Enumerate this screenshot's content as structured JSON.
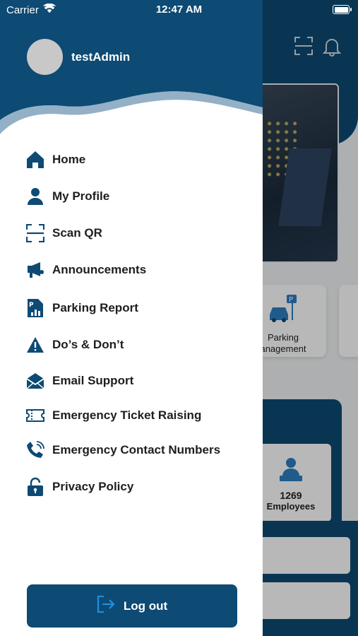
{
  "status_bar": {
    "carrier": "Carrier",
    "time": "12:47 AM"
  },
  "drawer": {
    "username": "testAdmin",
    "menu": [
      {
        "label": "Home",
        "icon": "home-icon"
      },
      {
        "label": "My Profile",
        "icon": "profile-icon"
      },
      {
        "label": "Scan QR",
        "icon": "scan-qr-icon"
      },
      {
        "label": "Announcements",
        "icon": "megaphone-icon"
      },
      {
        "label": "Parking Report",
        "icon": "report-icon"
      },
      {
        "label": "Do’s & Don’t",
        "icon": "warning-icon"
      },
      {
        "label": "Email Support",
        "icon": "email-icon"
      },
      {
        "label": "Emergency Ticket Raising",
        "icon": "ticket-icon"
      },
      {
        "label": "Emergency Contact Numbers",
        "icon": "phone-icon"
      },
      {
        "label": "Privacy Policy",
        "icon": "lock-icon"
      }
    ],
    "logout_label": "Log out"
  },
  "background": {
    "tile_label_line1": "Parking",
    "tile_label_line2": "anagement",
    "stat_value": "1269",
    "stat_label": "Employees"
  },
  "colors": {
    "primary": "#0d4a74",
    "accent": "#1e8fe0"
  }
}
